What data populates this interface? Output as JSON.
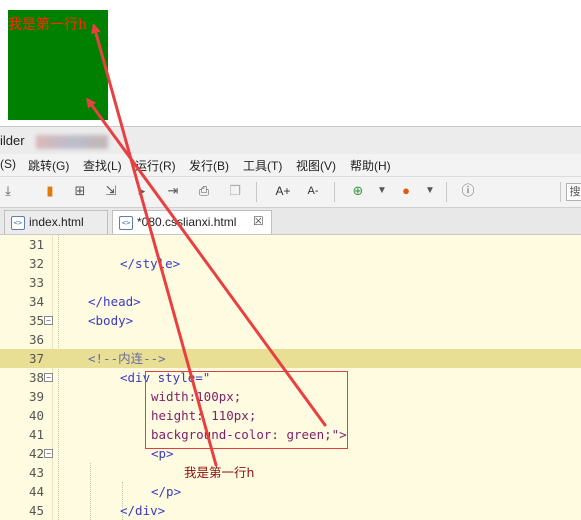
{
  "preview": {
    "paragraph_text": "我是第一行h",
    "box_color": "#008000",
    "text_color": "#ff2a00"
  },
  "window": {
    "title": "ilder"
  },
  "menu": [
    "(S)",
    "跳转(G)",
    "查找(L)",
    "运行(R)",
    "发行(B)",
    "工具(T)",
    "视图(V)",
    "帮助(H)"
  ],
  "toolbar": {
    "icons": [
      "pin-icon",
      "bookmark-icon",
      "new-file-icon",
      "export-icon",
      "run-icon",
      "step-icon",
      "save-icon",
      "copy-icon",
      "font-increase-icon",
      "font-decrease-icon",
      "add-icon",
      "dropdown-arrow-icon",
      "firefox-icon",
      "dropdown-arrow-icon",
      "info-icon"
    ],
    "font_increase": "A+",
    "font_decrease": "A-",
    "search_fragment": "搜"
  },
  "tabs": [
    {
      "label": "index.html",
      "active": false
    },
    {
      "label": "*080.csslianxi.html",
      "active": true,
      "close": "☒"
    }
  ],
  "editor": {
    "lines": [
      {
        "n": "31",
        "code": ""
      },
      {
        "n": "32",
        "code": "</style>"
      },
      {
        "n": "33",
        "code": ""
      },
      {
        "n": "34",
        "code": "</head>"
      },
      {
        "n": "35",
        "code": "<body>"
      },
      {
        "n": "36",
        "code": ""
      },
      {
        "n": "37",
        "code": "<!--内连-->"
      },
      {
        "n": "38",
        "code": "<div style=\""
      },
      {
        "n": "39",
        "code": "width:100px;"
      },
      {
        "n": "40",
        "code": "height: 110px;"
      },
      {
        "n": "41",
        "code": "background-color: green;\">"
      },
      {
        "n": "42",
        "code": "<p>"
      },
      {
        "n": "43",
        "code": "我是第一行h"
      },
      {
        "n": "44",
        "code": "</p>"
      },
      {
        "n": "45",
        "code": "</div>"
      }
    ]
  },
  "colors": {
    "editor_bg": "#fffbe0",
    "highlight": "#e8df95",
    "annotation": "#e84040"
  }
}
